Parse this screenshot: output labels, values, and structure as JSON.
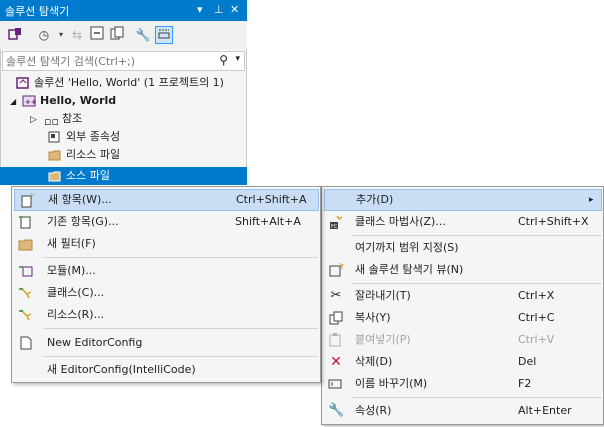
{
  "solution_explorer": {
    "title": "솔루션 탐색기",
    "title_icons": [
      "▾",
      "⊥",
      "✕"
    ],
    "search_placeholder": "솔루션 탐색기 검색(Ctrl+;)",
    "solution_label": "솔루션 'Hello, World' (1 프로젝트의 1)",
    "project_label": "Hello, World",
    "references_label": "참조",
    "external_deps_label": "외부 종속성",
    "resource_files_label": "리소스 파일",
    "source_files_label": "소스 파일"
  },
  "context_menu": {
    "items": [
      {
        "label": "추가(D)",
        "shortcut": "",
        "icon": "",
        "submenu_arrow": "▸"
      },
      {
        "label": "클래스 마법사(Z)...",
        "shortcut": "Ctrl+Shift+X",
        "icon": "class-wizard-icon"
      },
      {
        "label": "여기까지 범위 지정(S)",
        "shortcut": "",
        "icon": ""
      },
      {
        "label": "새 솔루션 탐색기 뷰(N)",
        "shortcut": "",
        "icon": "new-view-icon"
      },
      {
        "label": "잘라내기(T)",
        "shortcut": "Ctrl+X",
        "icon": "scissors-icon"
      },
      {
        "label": "복사(Y)",
        "shortcut": "Ctrl+C",
        "icon": "copy-icon"
      },
      {
        "label": "붙여넣기(P)",
        "shortcut": "Ctrl+V",
        "icon": "paste-icon"
      },
      {
        "label": "삭제(D)",
        "shortcut": "Del",
        "icon": "delete-icon"
      },
      {
        "label": "이름 바꾸기(M)",
        "shortcut": "F2",
        "icon": "rename-icon"
      },
      {
        "label": "속성(R)",
        "shortcut": "Alt+Enter",
        "icon": "wrench-icon"
      }
    ]
  },
  "submenu": {
    "items": [
      {
        "label": "새 항목(W)...",
        "shortcut": "Ctrl+Shift+A",
        "icon": "new-item-icon"
      },
      {
        "label": "기존 항목(G)...",
        "shortcut": "Shift+Alt+A",
        "icon": "existing-item-icon"
      },
      {
        "label": "새 필터(F)",
        "shortcut": "",
        "icon": "folder-icon"
      },
      {
        "label": "모듈(M)...",
        "shortcut": "",
        "icon": "module-icon"
      },
      {
        "label": "클래스(C)...",
        "shortcut": "",
        "icon": "class-icon"
      },
      {
        "label": "리소스(R)...",
        "shortcut": "",
        "icon": "resource-icon"
      },
      {
        "label": "New EditorConfig",
        "shortcut": "",
        "icon": "editorconfig-icon"
      },
      {
        "label": "새 EditorConfig(IntelliCode)",
        "shortcut": "",
        "icon": ""
      }
    ]
  },
  "colors": {
    "accent": "#007acc",
    "menu_bg": "#f5f5f5",
    "selection": "#c9def5",
    "disabled": "#a2a2a2",
    "delete_red": "#c5172b"
  }
}
